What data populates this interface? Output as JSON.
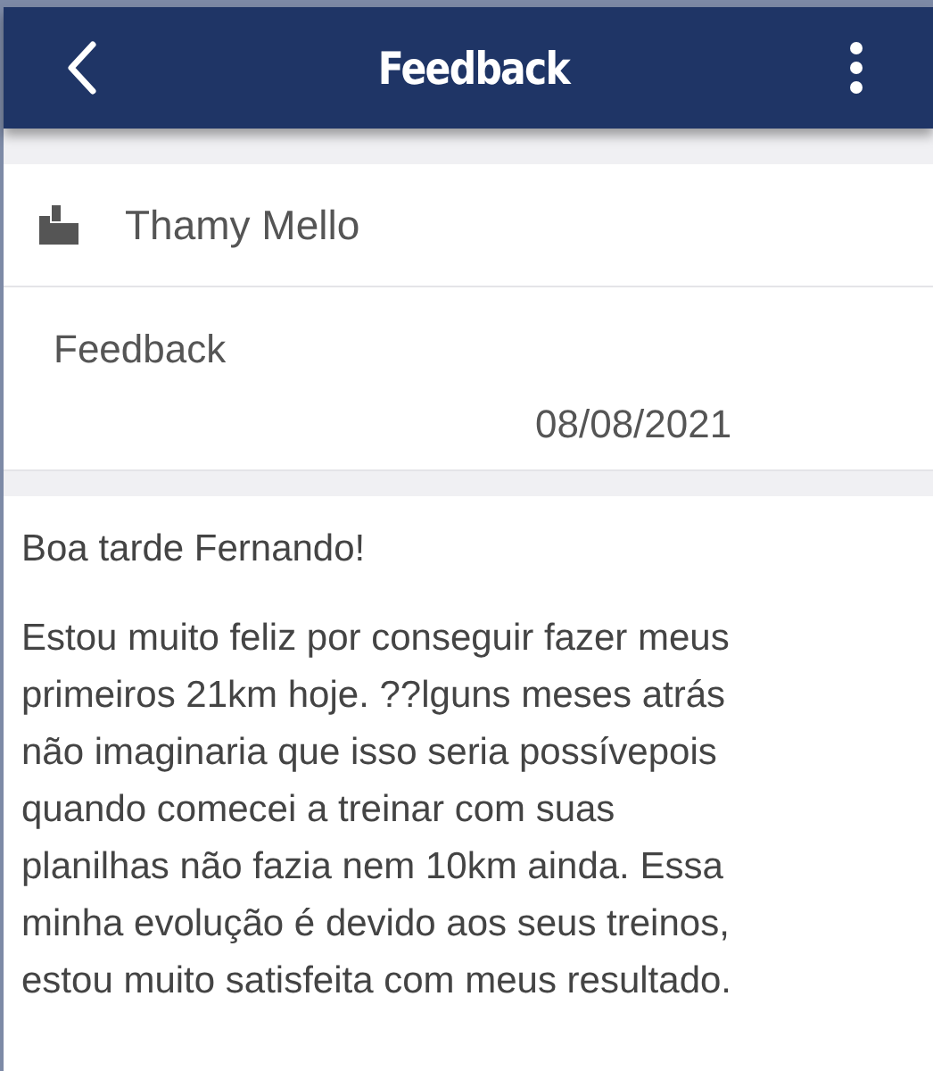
{
  "header": {
    "title": "Feedback"
  },
  "sender": {
    "name": "Thamy Mello"
  },
  "entry": {
    "type": "Feedback",
    "date": "08/08/2021"
  },
  "message": {
    "greeting": "Boa tarde Fernando!",
    "lines": [
      "Estou muito feliz por conseguir fazer meus",
      "primeiros 21km hoje. ??lguns meses atrás",
      "não imaginaria que isso seria possívepois",
      "quando comecei a treinar com suas",
      "planilhas não fazia nem 10km ainda. Essa",
      "minha evolução é devido aos seus treinos,",
      "estou muito satisfeita com meus resultado."
    ]
  }
}
